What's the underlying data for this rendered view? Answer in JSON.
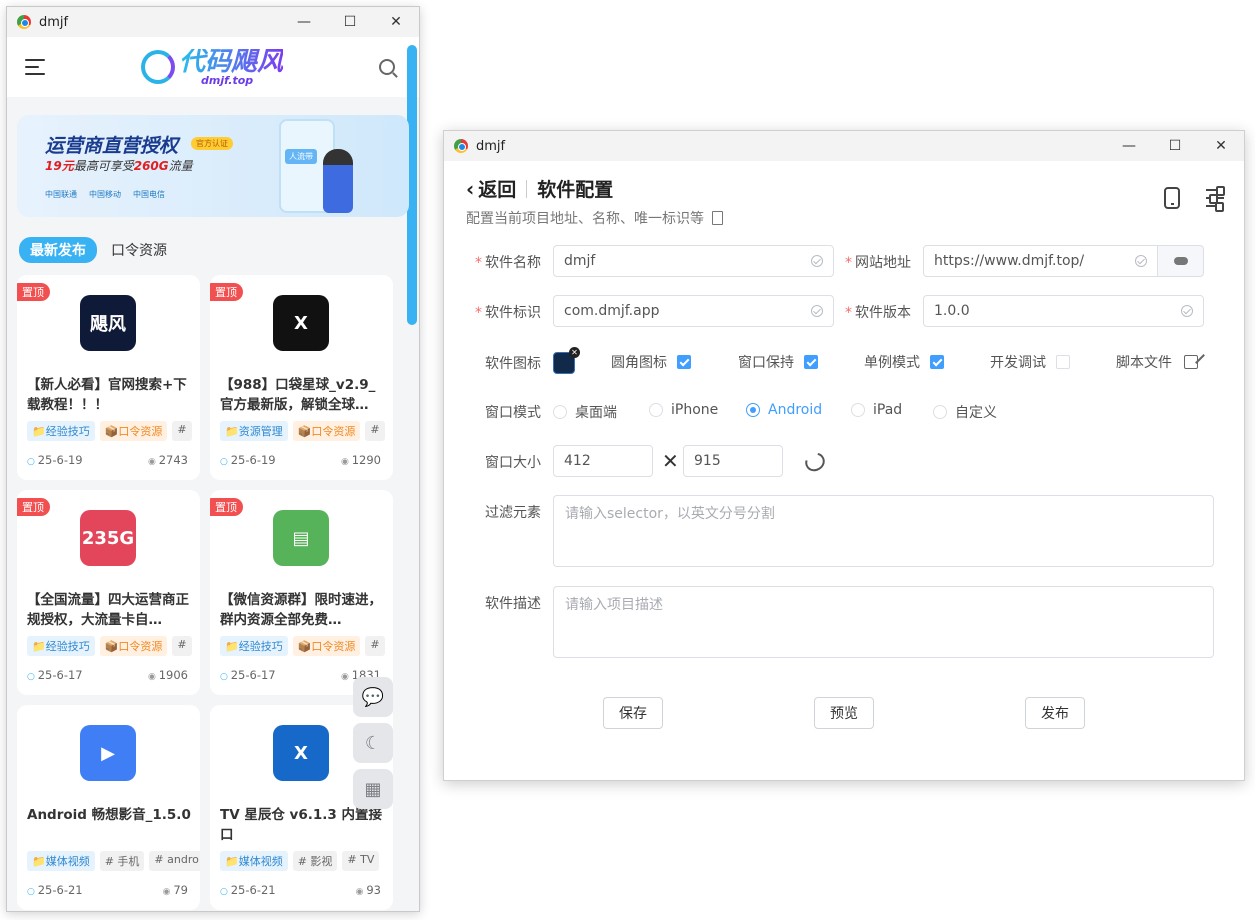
{
  "left_window": {
    "title": "dmjf",
    "brand": {
      "name_cn": "代码飓风",
      "url": "dmjf.top"
    },
    "banner": {
      "title": "运营商直营授权",
      "badge": "官方认证",
      "subtitle_prefix": "19元",
      "subtitle_mid": "最高可享受",
      "subtitle_highlight": "260G",
      "subtitle_suffix": "流量",
      "carriers": [
        "中国联通",
        "中国移动",
        "中国电信"
      ],
      "art_tag": "人流带"
    },
    "tabs": [
      "最新发布",
      "口令资源"
    ],
    "cards": [
      {
        "pinned": "置顶",
        "thumb_text": "飓风",
        "thumb_color": "#0e1a38",
        "title": "【新人必看】官网搜索+下载教程！！！",
        "tags": [
          {
            "t": "📁经验技巧",
            "c": "blue"
          },
          {
            "t": "📦口令资源",
            "c": "orange"
          },
          {
            "t": "#",
            "c": "gray"
          }
        ],
        "date": "25-6-19",
        "views": "2743"
      },
      {
        "pinned": "置顶",
        "thumb_text": "X",
        "thumb_color": "#111111",
        "title": "【988】口袋星球_v2.9_官方最新版，解锁全球…",
        "tags": [
          {
            "t": "📁资源管理",
            "c": "blue"
          },
          {
            "t": "📦口令资源",
            "c": "orange"
          },
          {
            "t": "#",
            "c": "gray"
          }
        ],
        "date": "25-6-19",
        "views": "1290"
      },
      {
        "pinned": "置顶",
        "thumb_text": "235G",
        "thumb_color": "#e3455a",
        "title": "【全国流量】四大运营商正规授权，大流量卡自…",
        "tags": [
          {
            "t": "📁经验技巧",
            "c": "blue"
          },
          {
            "t": "📦口令资源",
            "c": "orange"
          },
          {
            "t": "#",
            "c": "gray"
          }
        ],
        "date": "25-6-17",
        "views": "1906"
      },
      {
        "pinned": "置顶",
        "thumb_text": "▤",
        "thumb_color": "#56b35a",
        "title": "【微信资源群】限时速进，群内资源全部免费…",
        "tags": [
          {
            "t": "📁经验技巧",
            "c": "blue"
          },
          {
            "t": "📦口令资源",
            "c": "orange"
          },
          {
            "t": "#",
            "c": "gray"
          }
        ],
        "date": "25-6-17",
        "views": "1831"
      },
      {
        "pinned": "",
        "thumb_text": "▶",
        "thumb_color": "#3f7ef5",
        "title": "Android 畅想影音_1.5.0",
        "tags": [
          {
            "t": "📁媒体视频",
            "c": "blue"
          },
          {
            "t": "# 手机",
            "c": "gray"
          },
          {
            "t": "# andro",
            "c": "gray"
          }
        ],
        "date": "25-6-21",
        "views": "79"
      },
      {
        "pinned": "",
        "thumb_text": "X",
        "thumb_color": "#1769c9",
        "title": "TV 星辰仓 v6.1.3 内置接口",
        "tags": [
          {
            "t": "📁媒体视频",
            "c": "blue"
          },
          {
            "t": "# 影视",
            "c": "gray"
          },
          {
            "t": "# TV",
            "c": "gray"
          }
        ],
        "date": "25-6-21",
        "views": "93"
      }
    ]
  },
  "right_window": {
    "title": "dmjf",
    "back_label": "返回",
    "page_title": "软件配置",
    "subtitle": "配置当前项目地址、名称、唯一标识等",
    "fields": {
      "name_label": "软件名称",
      "name_value": "dmjf",
      "url_label": "网站地址",
      "url_value": "https://www.dmjf.top/",
      "id_label": "软件标识",
      "id_value": "com.dmjf.app",
      "version_label": "软件版本",
      "version_value": "1.0.0"
    },
    "options": {
      "icon_label": "软件图标",
      "round_icon": "圆角图标",
      "keep_window": "窗口保持",
      "single_instance": "单例模式",
      "dev_debug": "开发调试",
      "script_file": "脚本文件"
    },
    "window_mode": {
      "label": "窗口模式",
      "choices": [
        "桌面端",
        "iPhone",
        "Android",
        "iPad",
        "自定义"
      ],
      "selected": "Android"
    },
    "window_size": {
      "label": "窗口大小",
      "width": "412",
      "height": "915",
      "times": "✕"
    },
    "filter": {
      "label": "过滤元素",
      "placeholder": "请输入selector，以英文分号分割"
    },
    "description": {
      "label": "软件描述",
      "placeholder": "请输入项目描述"
    },
    "buttons": {
      "save": "保存",
      "preview": "预览",
      "publish": "发布"
    }
  }
}
